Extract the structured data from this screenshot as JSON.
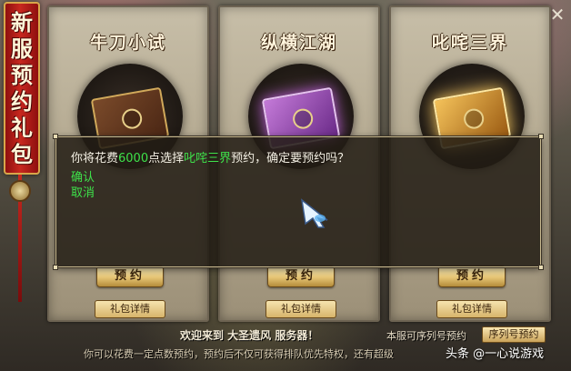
{
  "banner": {
    "chars": [
      "新",
      "服",
      "预",
      "约",
      "礼",
      "包"
    ]
  },
  "close": {
    "symbol": "✕"
  },
  "cards": [
    {
      "title": "牛刀小试",
      "reserve_label": "预约",
      "detail_label": "礼包详情"
    },
    {
      "title": "纵横江湖",
      "reserve_label": "预约",
      "detail_label": "礼包详情"
    },
    {
      "title": "叱咤三界",
      "reserve_label": "预约",
      "detail_label": "礼包详情"
    }
  ],
  "dialog": {
    "msg_prefix": "你将花费",
    "cost": "6000",
    "msg_mid": "点选择",
    "package": "叱咤三界",
    "msg_suffix": "预约，确定要预约吗？",
    "confirm": "确认",
    "cancel": "取消"
  },
  "footer": {
    "welcome": "欢迎来到 大圣遗风 服务器！",
    "serial_note": "本服可序列号预约",
    "serial_button": "序列号预约",
    "description": "你可以花费一定点数预约，预约后不仅可获得排队优先特权，还有超级"
  },
  "watermark": "头条 @一心说游戏",
  "colors": {
    "highlight": "#3ee24a",
    "banner_red": "#c8281f",
    "gold": "#d8a64a"
  },
  "icons": {
    "cursor": "feather-cursor-icon",
    "close": "close-icon",
    "knot": "jade-knot-icon"
  }
}
